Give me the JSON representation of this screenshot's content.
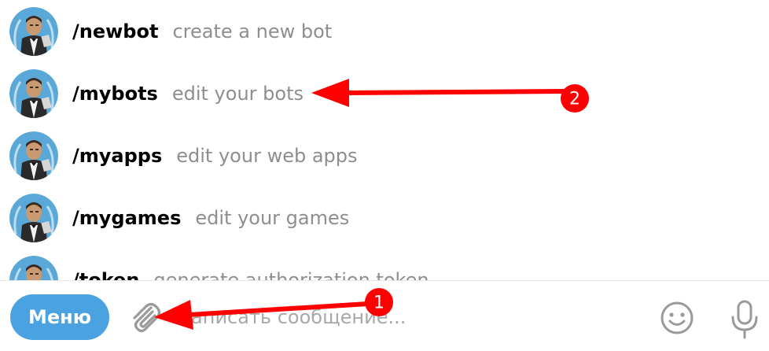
{
  "commands": [
    {
      "name": "/newbot",
      "description": "create a new bot"
    },
    {
      "name": "/mybots",
      "description": "edit your bots"
    },
    {
      "name": "/myapps",
      "description": "edit your web apps"
    },
    {
      "name": "/mygames",
      "description": "edit your games"
    },
    {
      "name": "/token",
      "description": "generate authorization token"
    }
  ],
  "composer": {
    "menu_label": "Меню",
    "placeholder": "Написать сообщение...",
    "attach_icon": "paperclip-icon",
    "emoji_icon": "smiley-icon",
    "mic_icon": "microphone-icon"
  },
  "annotations": [
    {
      "label": "1",
      "color": "#ff0000"
    },
    {
      "label": "2",
      "color": "#ff0000"
    }
  ],
  "colors": {
    "accent": "#4aa3e0",
    "command": "#000000",
    "description": "#8e8e8e",
    "annotation": "#ff0000"
  }
}
